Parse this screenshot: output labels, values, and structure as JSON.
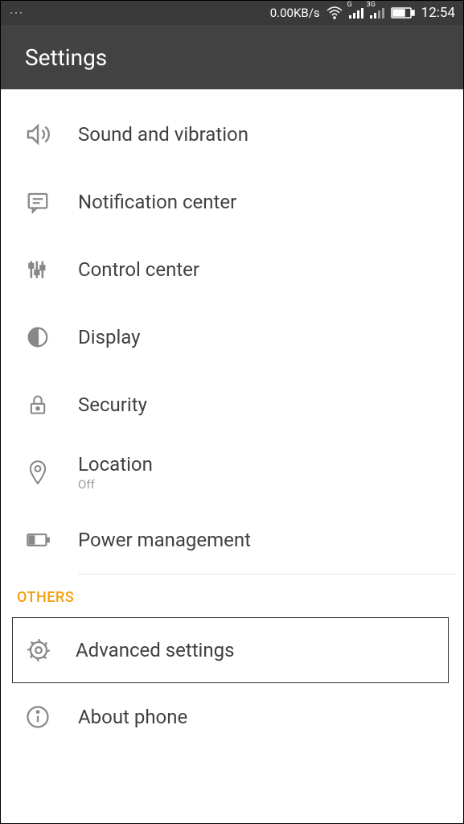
{
  "statusBar": {
    "speed": "0.00KB/s",
    "networkBadge1": "G",
    "networkBadge2": "3G",
    "time": "12:54"
  },
  "header": {
    "title": "Settings"
  },
  "items": [
    {
      "label": "Sound and vibration"
    },
    {
      "label": "Notification center"
    },
    {
      "label": "Control center"
    },
    {
      "label": "Display"
    },
    {
      "label": "Security"
    },
    {
      "label": "Location",
      "sublabel": "Off"
    },
    {
      "label": "Power management"
    }
  ],
  "section": {
    "header": "OTHERS"
  },
  "otherItems": [
    {
      "label": "Advanced settings"
    },
    {
      "label": "About phone"
    }
  ]
}
